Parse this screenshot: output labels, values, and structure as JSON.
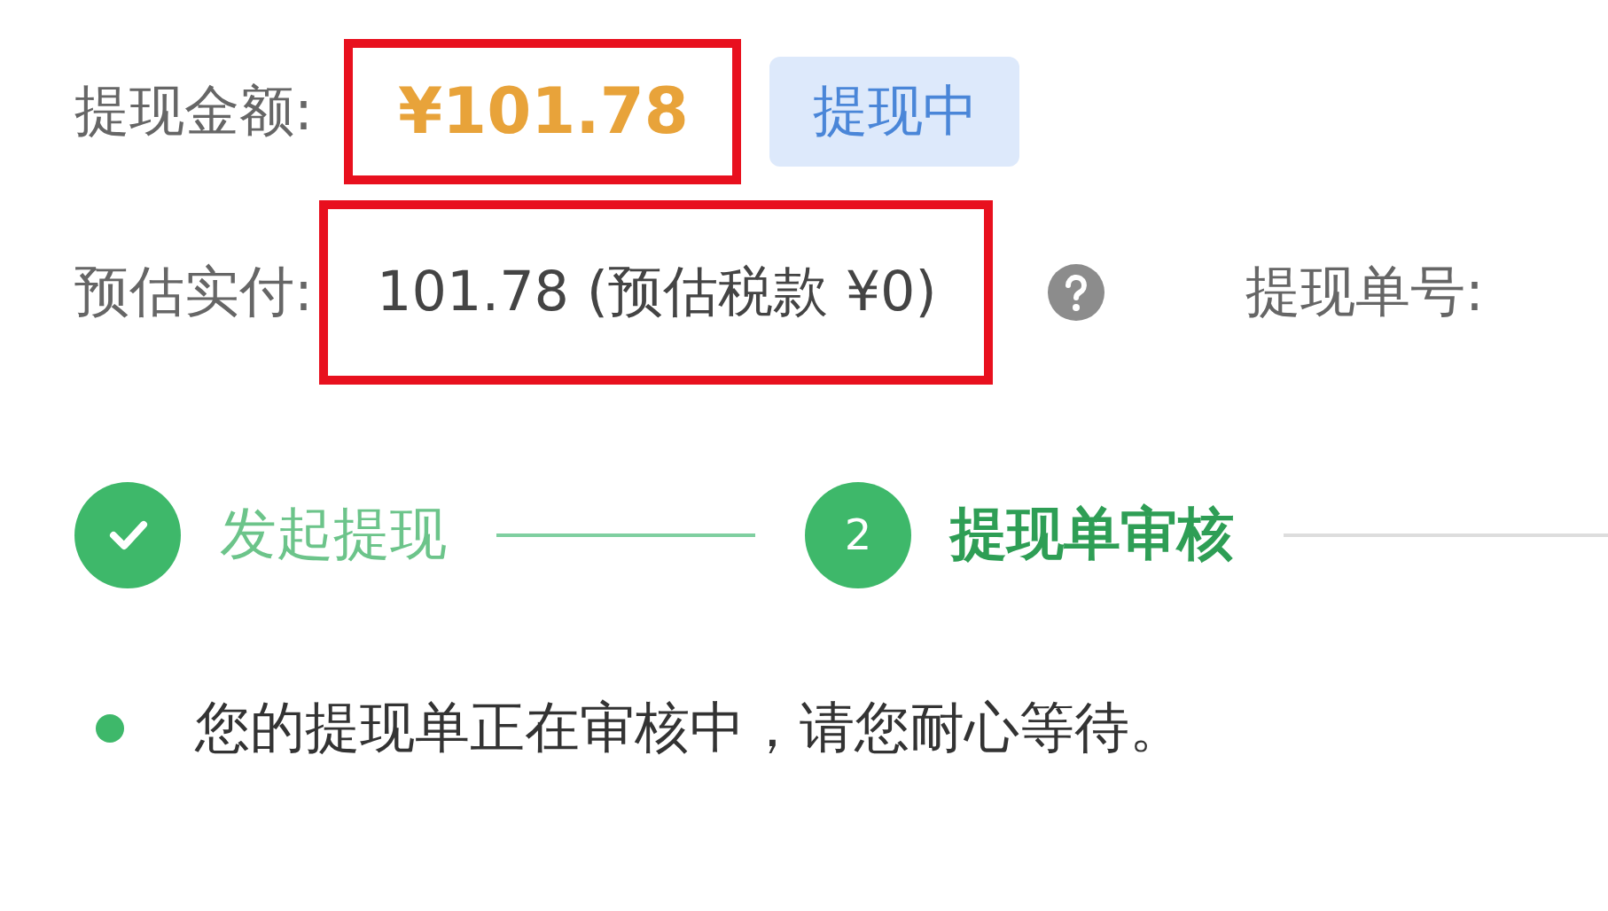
{
  "amount_row": {
    "label": "提现金额:",
    "value": "¥101.78",
    "highlighted": true,
    "badge": "提现中"
  },
  "estimate_row": {
    "label": "预估实付:",
    "value": "101.78 (预估税款 ¥0)",
    "highlighted": true,
    "help_icon": true,
    "order_label": "提现单号:"
  },
  "steps": [
    {
      "label": "发起提现",
      "completed": true,
      "current": false
    },
    {
      "label": "提现单审核",
      "number": "2",
      "completed": false,
      "current": true
    }
  ],
  "note": {
    "text": "您的提现单正在审核中，请您耐心等待。"
  }
}
